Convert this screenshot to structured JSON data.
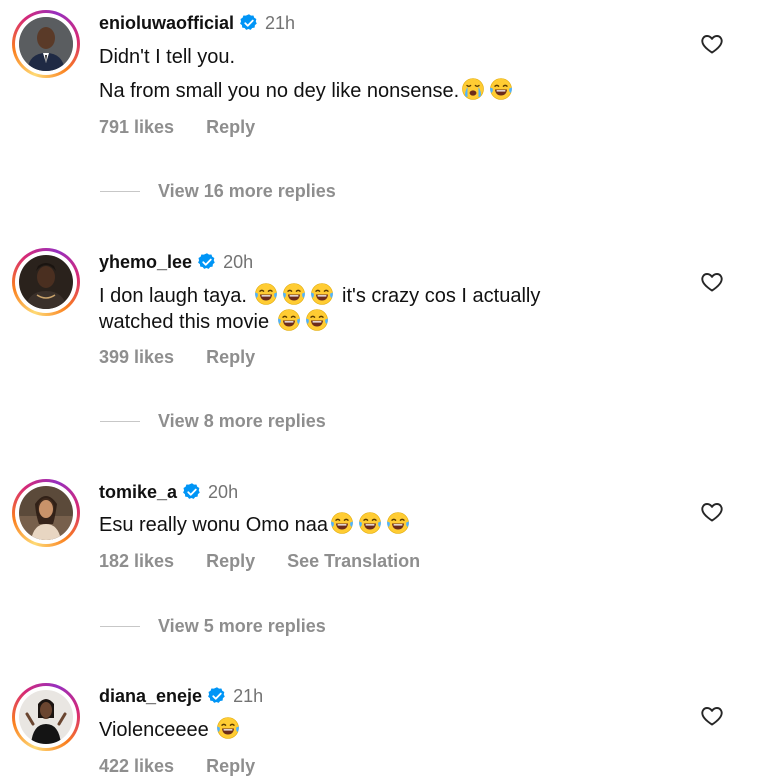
{
  "comments": [
    {
      "username": "enioluwaofficial",
      "verified": true,
      "time": "21h",
      "text_lines": [
        "Didn't I tell you.",
        "Na from small you no dey like nonsense."
      ],
      "likes": "791 likes",
      "reply": "Reply",
      "view_replies": "View 16 more replies"
    },
    {
      "username": "yhemo_lee",
      "verified": true,
      "time": "20h",
      "text_lines": [
        "I don laugh taya.",
        "it's crazy cos I actually",
        "watched this movie"
      ],
      "likes": "399 likes",
      "reply": "Reply",
      "view_replies": "View 8 more replies"
    },
    {
      "username": "tomike_a",
      "verified": true,
      "time": "20h",
      "text_lines": [
        "Esu really wonu Omo naa"
      ],
      "likes": "182 likes",
      "reply": "Reply",
      "see_translation": "See Translation",
      "view_replies": "View 5 more replies"
    },
    {
      "username": "diana_eneje",
      "verified": true,
      "time": "21h",
      "text_lines": [
        "Violenceeee"
      ],
      "likes": "422 likes",
      "reply": "Reply"
    }
  ],
  "icons": {
    "verified": "verified-badge-icon",
    "like": "heart-outline-icon",
    "emoji_laugh": "face-with-tears-of-joy-icon",
    "emoji_cry": "loudly-crying-face-icon"
  },
  "colors": {
    "verified_blue": "#0095f6",
    "secondary_text": "#8e8e8e",
    "primary_text": "#111111"
  }
}
